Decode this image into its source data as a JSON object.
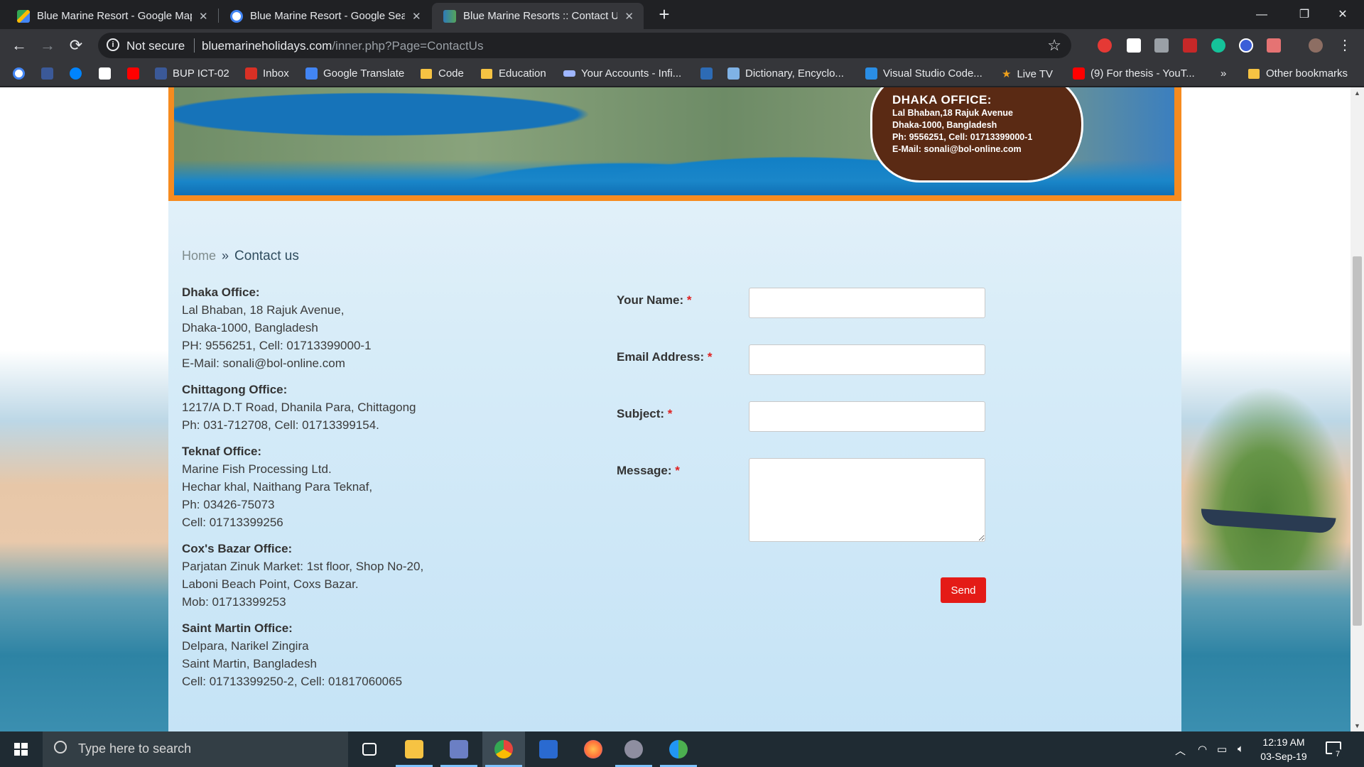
{
  "browser": {
    "tabs": [
      {
        "title": "Blue Marine Resort - Google Maps",
        "favicon": "google-maps-icon",
        "active": false
      },
      {
        "title": "Blue Marine Resort - Google Search",
        "favicon": "google-icon",
        "active": false
      },
      {
        "title": "Blue Marine Resorts :: Contact Us",
        "favicon": "site-icon",
        "active": true
      }
    ],
    "new_tab": "+",
    "window_controls": {
      "minimize": "—",
      "maximize": "❐",
      "close": "✕"
    },
    "security_label": "Not secure",
    "url_host": "bluemarineholidays.com",
    "url_path": "/inner.php?Page=ContactUs",
    "bookmarks": [
      {
        "label": "",
        "icon": "google-icon",
        "color": "#ffffff"
      },
      {
        "label": "",
        "icon": "facebook-icon",
        "color": "#3b5998"
      },
      {
        "label": "",
        "icon": "messenger-icon",
        "color": "#0084ff"
      },
      {
        "label": "",
        "icon": "wikipedia-icon",
        "color": "#ffffff"
      },
      {
        "label": "",
        "icon": "youtube-icon",
        "color": "#ff0000"
      },
      {
        "label": "BUP ICT-02",
        "icon": "facebook-icon",
        "color": "#3b5998"
      },
      {
        "label": "Inbox",
        "icon": "gmail-icon",
        "color": "#d93025"
      },
      {
        "label": "Google Translate",
        "icon": "translate-icon",
        "color": "#4285f4"
      },
      {
        "label": "Code",
        "icon": "folder-icon",
        "color": "#f6c343"
      },
      {
        "label": "Education",
        "icon": "folder-icon",
        "color": "#f6c343"
      },
      {
        "label": "Your Accounts - Infi...",
        "icon": "infinity-icon",
        "color": "#9fb6ff"
      },
      {
        "label": "",
        "icon": "dictionary-icon",
        "color": "#2d6bb5"
      },
      {
        "label": "Dictionary, Encyclo...",
        "icon": "encyclopedia-icon",
        "color": "#7fb2e5"
      },
      {
        "label": "Visual Studio Code...",
        "icon": "vscode-icon",
        "color": "#2a8ee5"
      },
      {
        "label": "Live TV",
        "icon": "star-icon",
        "color": "#f0a11c"
      },
      {
        "label": "(9) For thesis - YouT...",
        "icon": "youtube-icon",
        "color": "#ff0000"
      }
    ],
    "bookmarks_overflow": "»",
    "other_bookmarks": "Other bookmarks"
  },
  "banner": {
    "office_title": "DHAKA OFFICE:",
    "office_lines": [
      "Lal Bhaban,18 Rajuk Avenue",
      "Dhaka-1000, Bangladesh",
      "Ph: 9556251, Cell: 01713399000-1",
      "E-Mail: sonali@bol-online.com"
    ]
  },
  "breadcrumb": {
    "home": "Home",
    "separator": "»",
    "current": "Contact us"
  },
  "offices": [
    {
      "name": "Dhaka Office:",
      "lines": [
        "Lal Bhaban, 18 Rajuk Avenue,",
        "Dhaka-1000, Bangladesh",
        "PH: 9556251, Cell: 01713399000-1",
        "E-Mail: sonali@bol-online.com"
      ]
    },
    {
      "name": "Chittagong Office:",
      "lines": [
        "1217/A D.T Road, Dhanila Para, Chittagong",
        "Ph: 031-712708, Cell: 01713399154."
      ]
    },
    {
      "name": "Teknaf Office:",
      "lines": [
        "Marine Fish Processing Ltd.",
        "Hechar khal, Naithang Para Teknaf,",
        "Ph: 03426-75073",
        "Cell: 01713399256"
      ]
    },
    {
      "name": "Cox's Bazar Office:",
      "lines": [
        "Parjatan Zinuk Market: 1st floor, Shop No-20,",
        "Laboni Beach Point, Coxs Bazar.",
        "Mob: 01713399253"
      ]
    },
    {
      "name": "Saint Martin Office:",
      "lines": [
        "Delpara, Narikel Zingira",
        "Saint Martin, Bangladesh",
        "Cell: 01713399250-2, Cell: 01817060065"
      ]
    }
  ],
  "form": {
    "name_label": "Your Name:",
    "email_label": "Email Address:",
    "subject_label": "Subject:",
    "message_label": "Message:",
    "required_mark": "*",
    "name_value": "",
    "email_value": "",
    "subject_value": "",
    "message_value": "",
    "send_label": "Send"
  },
  "taskbar": {
    "search_placeholder": "Type here to search",
    "apps": [
      {
        "icon": "task-view-icon",
        "color": "#ffffff",
        "running": false,
        "active": false
      },
      {
        "icon": "file-explorer-icon",
        "color": "#f6c343",
        "running": true,
        "active": false
      },
      {
        "icon": "presentation-icon",
        "color": "#6b7fc4",
        "running": true,
        "active": false
      },
      {
        "icon": "chrome-icon",
        "color": "#e8453c",
        "running": true,
        "active": true
      },
      {
        "icon": "powershell-icon",
        "color": "#2a6ad0",
        "running": false,
        "active": false
      },
      {
        "icon": "firefox-icon",
        "color": "#ff7139",
        "running": false,
        "active": false
      },
      {
        "icon": "bittorrent-icon",
        "color": "#8e8ea0",
        "running": true,
        "active": false
      },
      {
        "icon": "transfer-icon",
        "color": "#4caf50",
        "running": true,
        "active": false
      }
    ],
    "time": "12:19 AM",
    "date": "03-Sep-19",
    "notification_count": "7"
  },
  "colors": {
    "banner_border": "#f68b1f",
    "send_button": "#e41b17",
    "required_mark": "#e02020"
  }
}
